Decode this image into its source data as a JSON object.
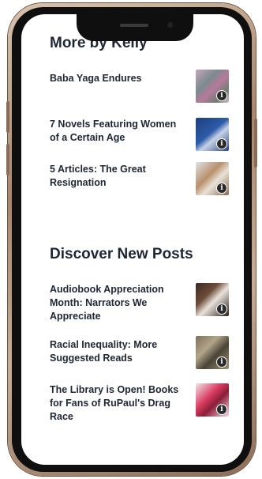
{
  "sections": [
    {
      "title": "More by Kelly",
      "posts": [
        {
          "title": "Baba Yaga Endures"
        },
        {
          "title": "7 Novels Featuring Women of a Certain Age"
        },
        {
          "title": "5 Articles: The Great Resignation"
        }
      ]
    },
    {
      "title": "Discover New Posts",
      "posts": [
        {
          "title": "Audiobook Appreciation Month: Narrators We Appreciate"
        },
        {
          "title": "Racial Inequality: More Suggested Reads"
        },
        {
          "title": "The Library is Open! Books for Fans of RuPaul's Drag Race"
        }
      ]
    }
  ],
  "info_icon": {
    "glyph": "i",
    "name": "info-icon"
  }
}
